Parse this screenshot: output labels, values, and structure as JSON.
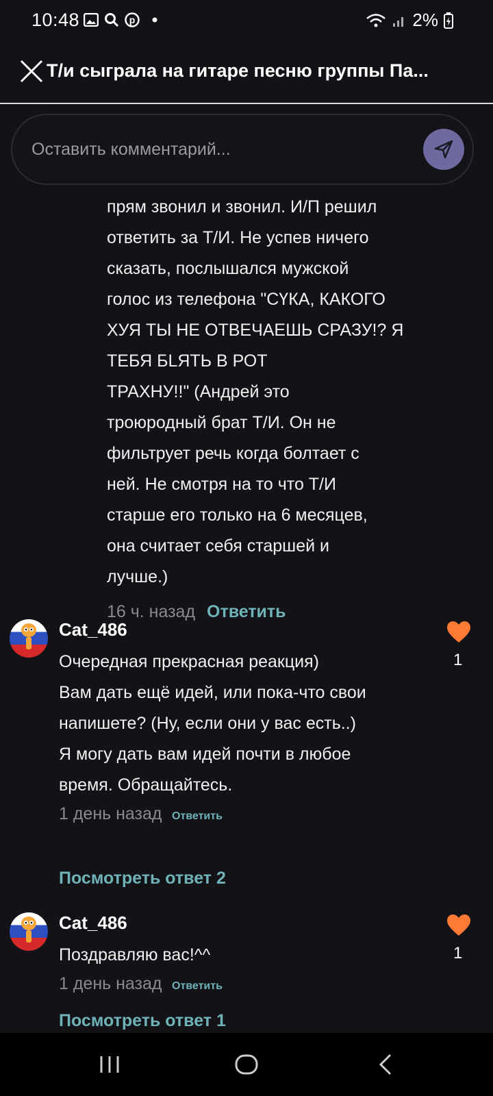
{
  "status_bar": {
    "time": "10:48",
    "battery": "2%",
    "notification_icons": [
      "gallery-icon",
      "search-icon",
      "pinterest-icon",
      "dot-icon"
    ]
  },
  "header": {
    "title": "Т/и сыграла на гитаре песню группы Па..."
  },
  "comment_input": {
    "placeholder": "Оставить комментарий..."
  },
  "partial_reply": {
    "lines": "прям звонил и звонил. И/П решил\nответить за Т/И. Не успев ничего\nсказать, послышался мужской\nголос из телефона \"СҮКА, КАКОГО\nХУЯ ТЫ НЕ ОТВЕЧАЕШЬ СРАЗУ!? Я\nТЕБЯ БLЯТЬ В РОТ\nТРАХНУ!!\" (Андрей это\nтроюродный брат Т/И. Он не\nфильтрует речь когда болтает с\nней. Не смотря на то что Т/И\nстарше его только на 6 месяцев,\nона считает себя старшей и\nлучше.)",
    "time": "16 ч. назад",
    "reply_label": "Ответить"
  },
  "comments": [
    {
      "username": "Cat_486",
      "text": "Очередная прекрасная реакция)\nВам дать ещё идей, или пока-что свои\nнапишете? (Ну, если они у вас есть..)\nЯ могу дать вам идей почти в любое\nвремя. Обращайтесь.",
      "time": "1 день назад",
      "reply_label": "Ответить",
      "likes": "1",
      "view_replies": "Посмотреть ответ 2"
    },
    {
      "username": "Cat_486",
      "text": "Поздравляю вас!^^",
      "time": "1 день назад",
      "reply_label": "Ответить",
      "likes": "1",
      "view_replies": "Посмотреть ответ 1"
    }
  ],
  "colors": {
    "background": "#121217",
    "accent": "#6fb3b8",
    "like": "#ff7a33",
    "send_button": "#6e6aa0"
  }
}
